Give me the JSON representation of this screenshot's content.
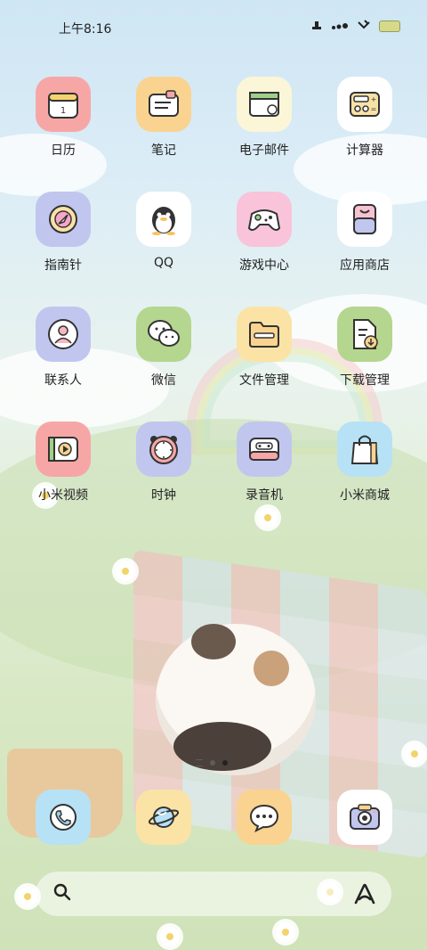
{
  "status_bar": {
    "time": "上午8:16"
  },
  "apps": [
    {
      "label": "日历",
      "icon": "calendar-icon",
      "bg": "#f7a6a6"
    },
    {
      "label": "笔记",
      "icon": "notes-icon",
      "bg": "#f9d38f"
    },
    {
      "label": "电子邮件",
      "icon": "email-icon",
      "bg": "#fbf6d8"
    },
    {
      "label": "计算器",
      "icon": "calculator-icon",
      "bg": "#ffffff"
    },
    {
      "label": "指南针",
      "icon": "compass-icon",
      "bg": "#c1c6ef"
    },
    {
      "label": "QQ",
      "icon": "qq-penguin-icon",
      "bg": "#ffffff"
    },
    {
      "label": "游戏中心",
      "icon": "gamepad-icon",
      "bg": "#f9c3da"
    },
    {
      "label": "应用商店",
      "icon": "app-store-icon",
      "bg": "#ffffff"
    },
    {
      "label": "联系人",
      "icon": "contacts-icon",
      "bg": "#c1c6ef"
    },
    {
      "label": "微信",
      "icon": "wechat-icon",
      "bg": "#b4d68e"
    },
    {
      "label": "文件管理",
      "icon": "folder-icon",
      "bg": "#fbe3a6"
    },
    {
      "label": "下载管理",
      "icon": "download-icon",
      "bg": "#b4d68e"
    },
    {
      "label": "小米视频",
      "icon": "video-play-icon",
      "bg": "#f7a6a6"
    },
    {
      "label": "时钟",
      "icon": "clock-icon",
      "bg": "#c1c6ef"
    },
    {
      "label": "录音机",
      "icon": "recorder-icon",
      "bg": "#c1c6ef"
    },
    {
      "label": "小米商城",
      "icon": "shopping-bag-icon",
      "bg": "#b7e1f5"
    }
  ],
  "dock": [
    {
      "icon": "phone-icon",
      "bg": "#b7e1f5"
    },
    {
      "icon": "browser-planet-icon",
      "bg": "#fbe3a6"
    },
    {
      "icon": "messages-icon",
      "bg": "#f9d38f"
    },
    {
      "icon": "camera-icon",
      "bg": "#ffffff"
    }
  ],
  "search": {
    "search_icon": "search-icon",
    "assistant_icon": "assistant-a-icon"
  },
  "page_indicator": {
    "pages": 2,
    "active": 2
  }
}
